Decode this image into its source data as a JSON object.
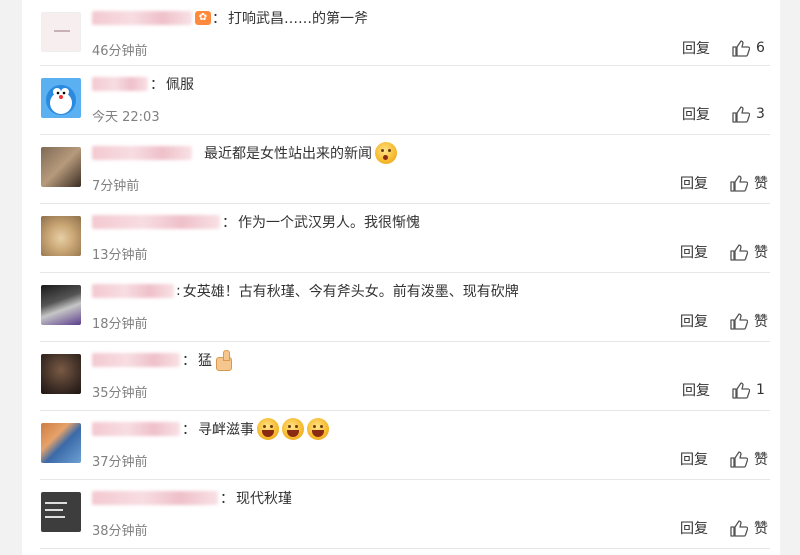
{
  "comments": [
    {
      "name_width": 100,
      "name_suffix_badge": "",
      "has_badge": true,
      "colon": "：",
      "text": "打响武昌……的第一斧",
      "emoji": "",
      "time": "46分钟前",
      "reply": "回复",
      "likes": "6"
    },
    {
      "name_width": 56,
      "has_badge": false,
      "colon": "：",
      "text": "佩服",
      "emoji": "",
      "time": "今天 22:03",
      "reply": "回复",
      "likes": "3"
    },
    {
      "name_width": 100,
      "has_badge": false,
      "colon": "",
      "text": "最近都是女性站出来的新闻",
      "emoji": "think",
      "time": "7分钟前",
      "reply": "回复",
      "likes": "赞"
    },
    {
      "name_width": 128,
      "has_badge": false,
      "colon": "：",
      "text": "作为一个武汉男人。我很惭愧",
      "emoji": "",
      "time": "13分钟前",
      "reply": "回复",
      "likes": "赞"
    },
    {
      "name_width": 82,
      "has_badge": false,
      "colon": ":",
      "text": "女英雄！古有秋瑾、今有斧头女。前有泼墨、现有砍牌",
      "emoji": "",
      "time": "18分钟前",
      "reply": "回复",
      "likes": "赞"
    },
    {
      "name_width": 88,
      "has_badge": false,
      "colon": "：",
      "text": "猛",
      "emoji": "thumb",
      "time": "35分钟前",
      "reply": "回复",
      "likes": "1"
    },
    {
      "name_width": 88,
      "has_badge": false,
      "colon": "：",
      "text": "寻衅滋事",
      "emoji": "laugh3",
      "time": "37分钟前",
      "reply": "回复",
      "likes": "赞"
    },
    {
      "name_width": 126,
      "has_badge": false,
      "colon": "：",
      "text": "现代秋瑾",
      "emoji": "",
      "time": "38分钟前",
      "reply": "回复",
      "likes": "赞"
    }
  ],
  "avatar_7_text": "2020.4.4\n宣记清演\n缠橘药务"
}
